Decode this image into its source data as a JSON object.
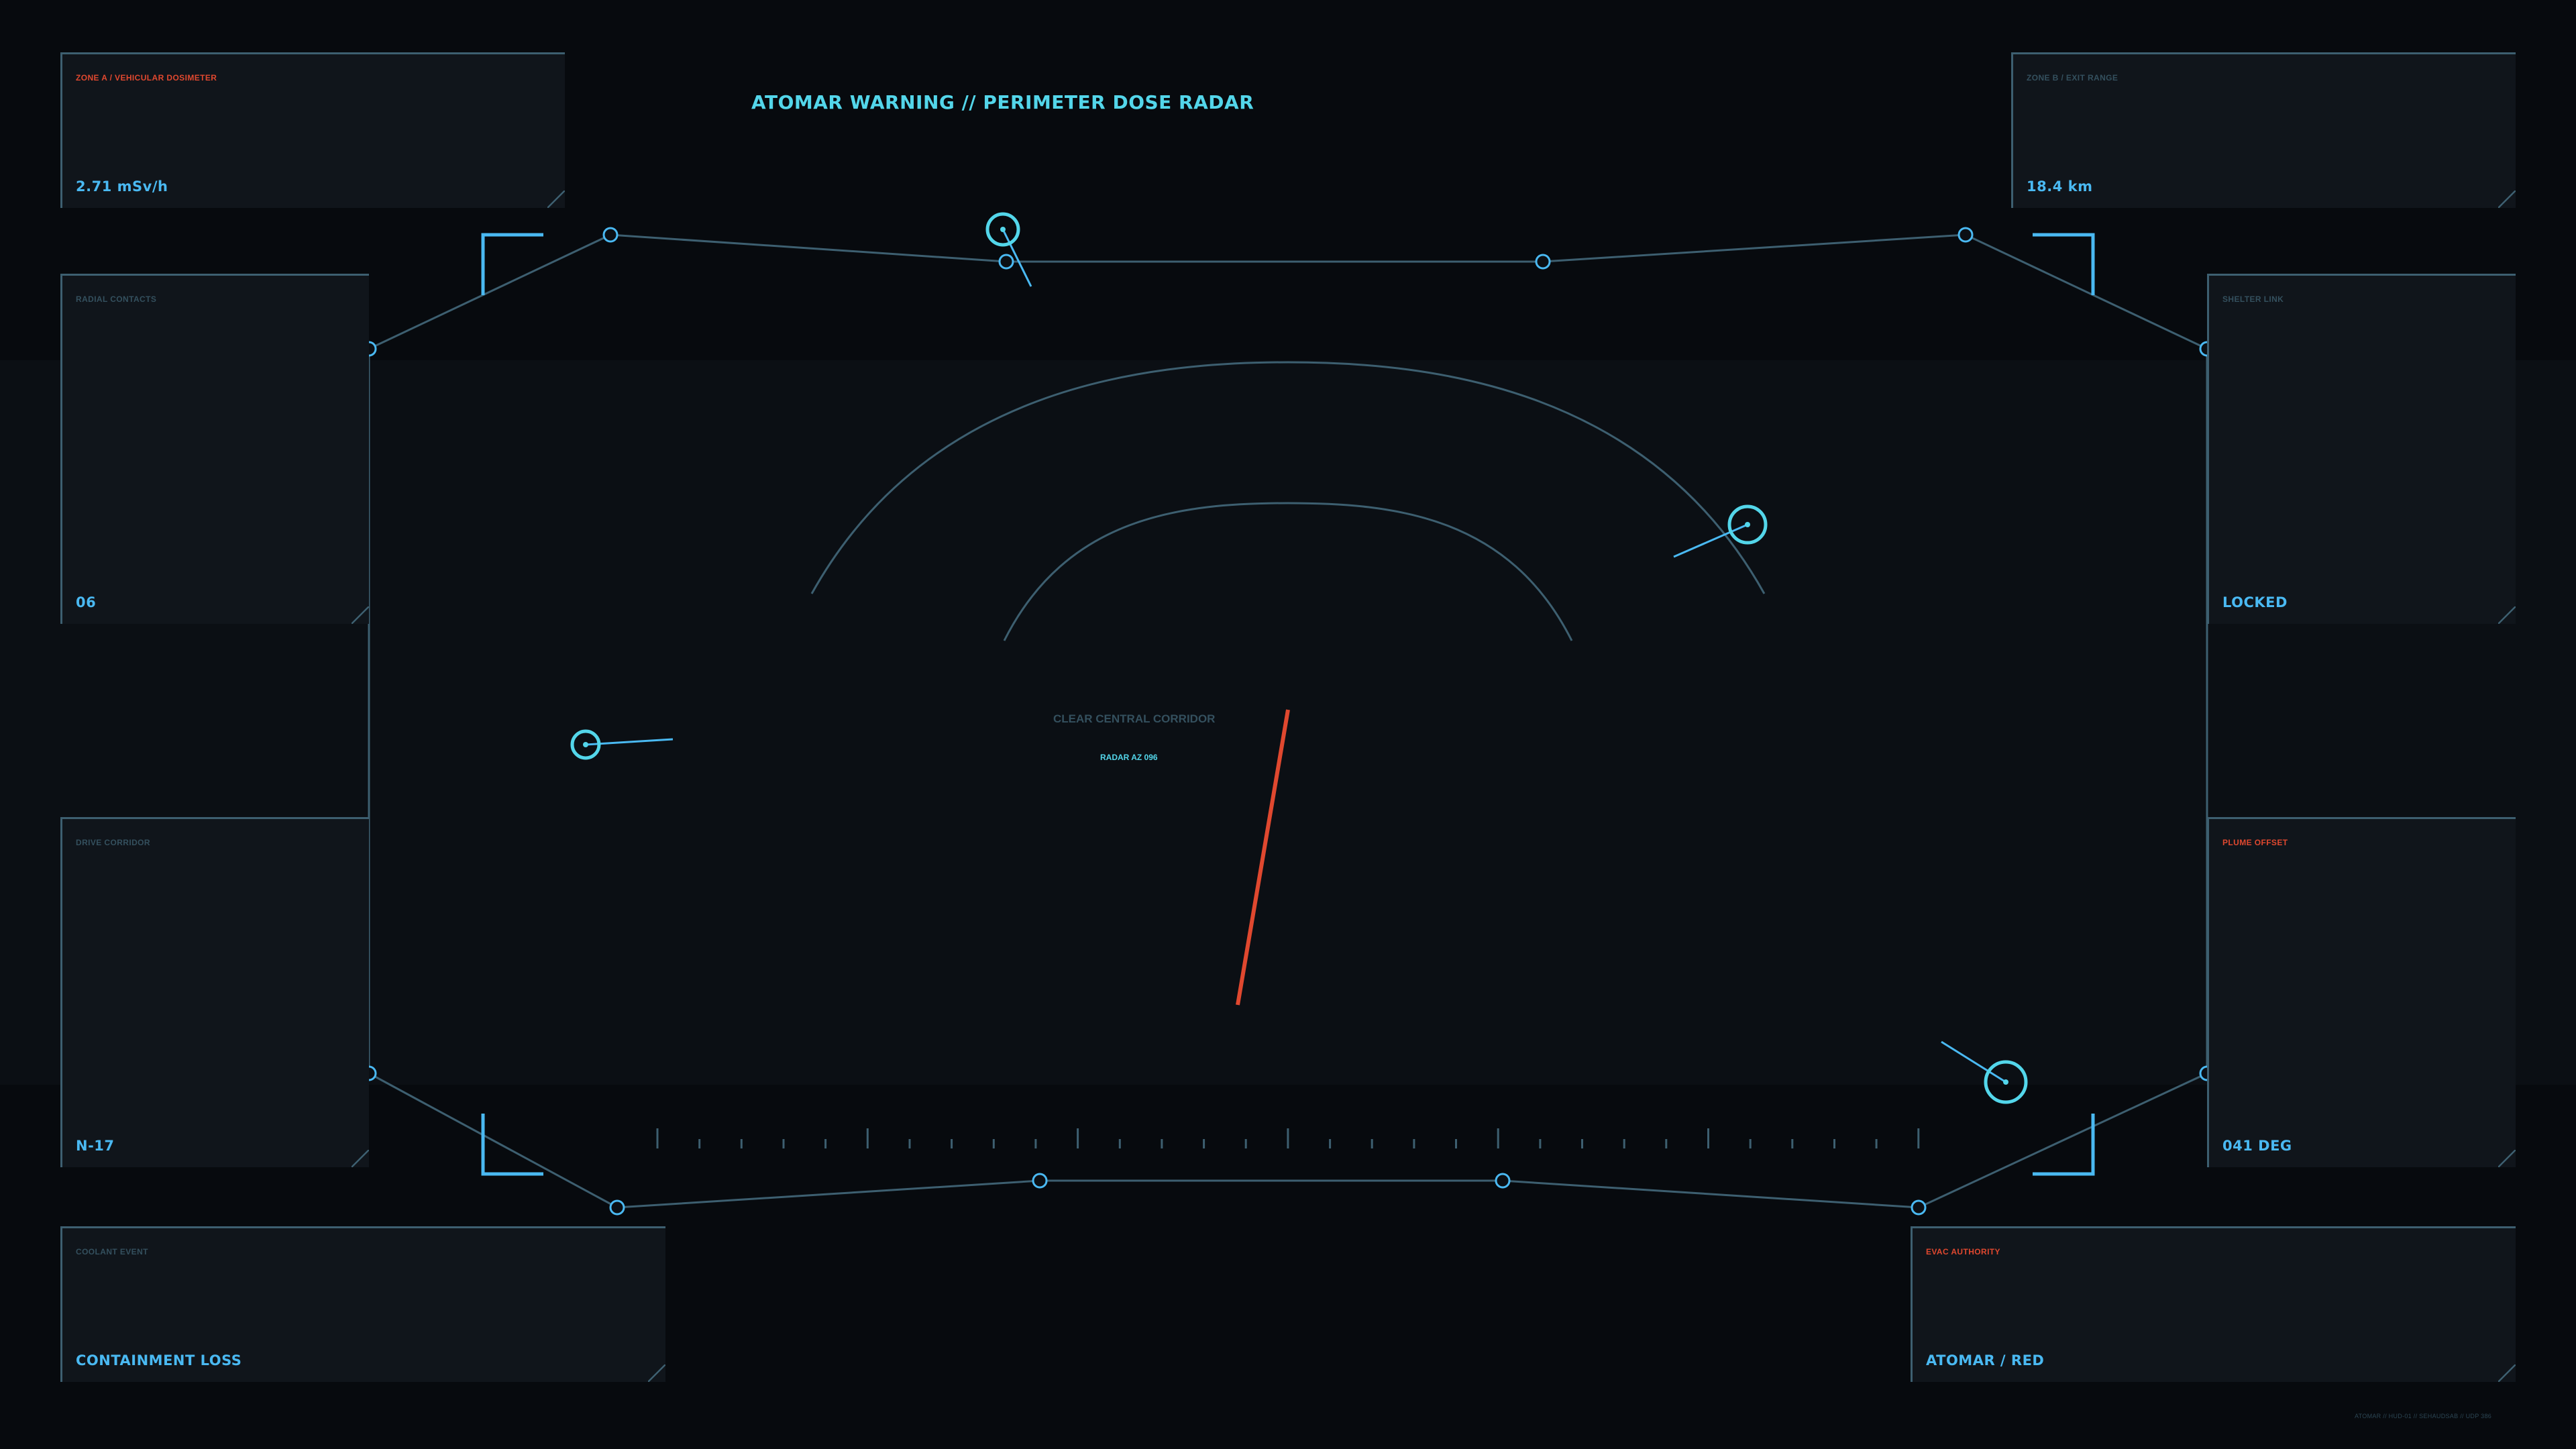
{
  "app": {
    "title": "ATOMAR WARNING // PERIMETER DOSE RADAR",
    "footer": "ATOMAR // HUD-01 // SEHAUDSAB // UDP 386"
  },
  "panels": {
    "zone_a": {
      "label": "ZONE A / VEHICULAR DOSIMETER",
      "value": "2.71 mSv/h",
      "alert": true
    },
    "zone_b": {
      "label": "ZONE B / EXIT RANGE",
      "value": "18.4 km",
      "alert": false
    },
    "radial_contacts": {
      "label": "RADIAL CONTACTS",
      "value": "06",
      "alert": false
    },
    "shelter_link": {
      "label": "SHELTER LINK",
      "value": "LOCKED",
      "alert": false
    },
    "drive_corridor": {
      "label": "DRIVE CORRIDOR",
      "value": "N-17",
      "alert": false
    },
    "plume_offset": {
      "label": "PLUME OFFSET",
      "value": "041 DEG",
      "alert": true
    },
    "coolant_event": {
      "label": "COOLANT EVENT",
      "value": "CONTAINMENT LOSS",
      "alert": false
    },
    "evac_authority": {
      "label": "EVAC AUTHORITY",
      "value": "ATOMAR / RED",
      "alert": true
    }
  },
  "radar": {
    "corridor_label": "CLEAR CENTRAL CORRIDOR",
    "azimuth_label": "RADAR AZ 096"
  },
  "colors": {
    "background": "#070a0e",
    "panel": "#10151b",
    "frame": "#3d5f70",
    "accent_cyan": "#53d6ea",
    "accent_blue": "#4ab9f2",
    "alert_red": "#e0482f"
  }
}
